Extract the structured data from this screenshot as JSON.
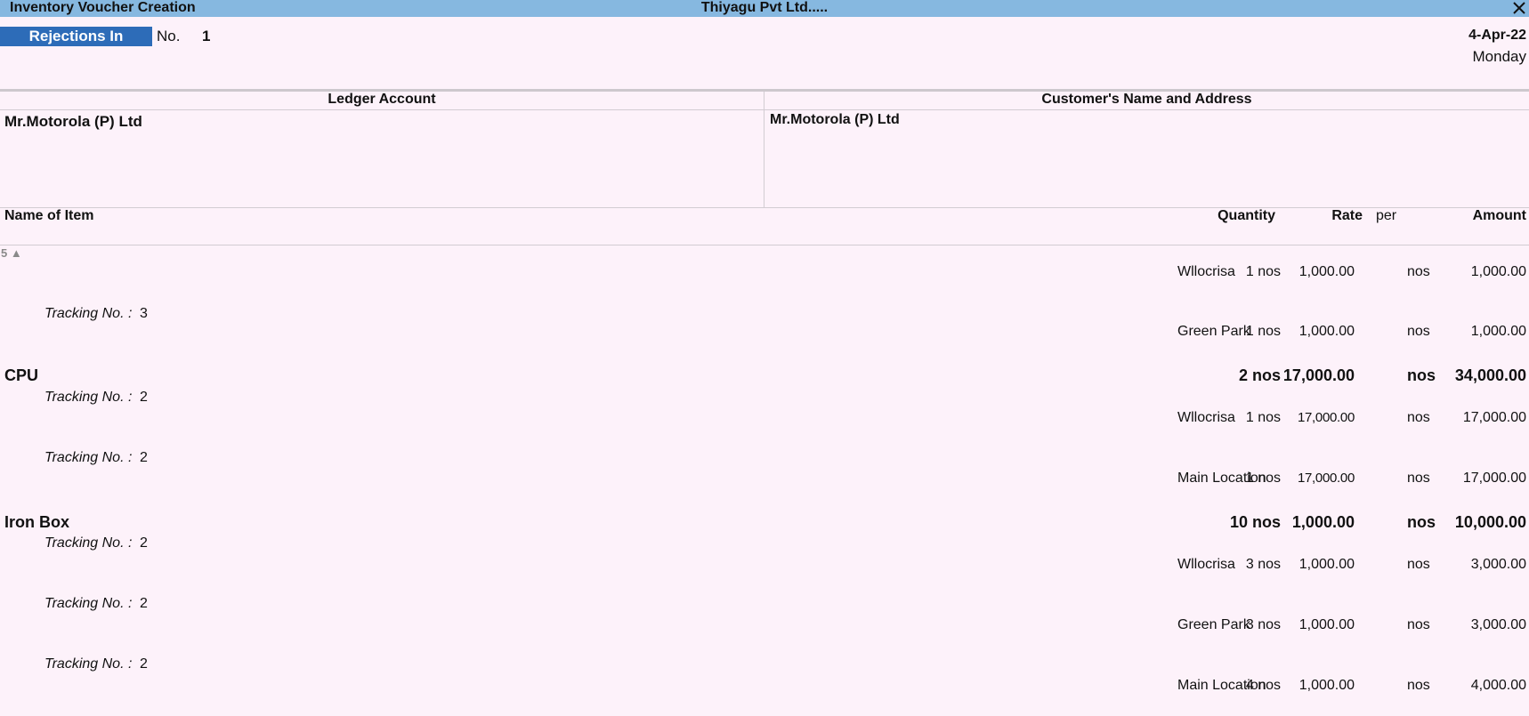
{
  "window": {
    "title": "Inventory Voucher Creation",
    "company": "Thiyagu Pvt Ltd.....",
    "close_icon": "close-icon"
  },
  "voucher": {
    "type": "Rejections In",
    "no_label": "No.",
    "no": "1",
    "date": "4-Apr-22",
    "day": "Monday"
  },
  "party": {
    "ledger_header": "Ledger Account",
    "ledger_value": "Mr.Motorola (P) Ltd",
    "customer_header": "Customer's Name and Address",
    "customer_value": "Mr.Motorola (P) Ltd"
  },
  "table": {
    "headers": {
      "name": "Name of Item",
      "quantity": "Quantity",
      "rate": "Rate",
      "per": "per",
      "amount": "Amount"
    },
    "scroll_indicator": "5 ▲",
    "rows": [
      {
        "kind": "loc",
        "location": "Wllocrisa",
        "qty": "1 nos",
        "rate": "1,000.00",
        "per": "nos",
        "amount": "1,000.00"
      },
      {
        "kind": "track",
        "label": "Tracking No. :",
        "value": "3"
      },
      {
        "kind": "loc",
        "location": "Green Park",
        "qty": "1 nos",
        "rate": "1,000.00",
        "per": "nos",
        "amount": "1,000.00"
      },
      {
        "kind": "item",
        "name": "CPU",
        "qty": "2 nos",
        "rate": "17,000.00",
        "per": "nos",
        "amount": "34,000.00"
      },
      {
        "kind": "track",
        "label": "Tracking No. :",
        "value": "2"
      },
      {
        "kind": "loc",
        "location": "Wllocrisa",
        "qty": "1 nos",
        "rate": "17,000.00",
        "per": "nos",
        "amount": "17,000.00"
      },
      {
        "kind": "track",
        "label": "Tracking No. :",
        "value": "2"
      },
      {
        "kind": "loc",
        "location": "Main Location",
        "qty": "1 nos",
        "rate": "17,000.00",
        "per": "nos",
        "amount": "17,000.00"
      },
      {
        "kind": "item",
        "name": "Iron Box",
        "qty": "10 nos",
        "rate": "1,000.00",
        "per": "nos",
        "amount": "10,000.00"
      },
      {
        "kind": "track",
        "label": "Tracking No. :",
        "value": "2"
      },
      {
        "kind": "loc",
        "location": "Wllocrisa",
        "qty": "3 nos",
        "rate": "1,000.00",
        "per": "nos",
        "amount": "3,000.00"
      },
      {
        "kind": "track",
        "label": "Tracking No. :",
        "value": "2"
      },
      {
        "kind": "loc",
        "location": "Green Park",
        "qty": "3 nos",
        "rate": "1,000.00",
        "per": "nos",
        "amount": "3,000.00"
      },
      {
        "kind": "track",
        "label": "Tracking No. :",
        "value": "2"
      },
      {
        "kind": "loc",
        "location": "Main Location",
        "qty": "4 nos",
        "rate": "1,000.00",
        "per": "nos",
        "amount": "4,000.00"
      }
    ]
  }
}
